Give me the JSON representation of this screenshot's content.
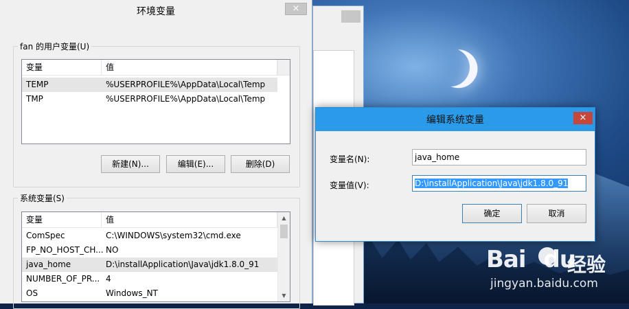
{
  "env_dialog": {
    "title": "环境变量",
    "close": "×",
    "user_group": {
      "label": "fan 的用户变量(U)",
      "columns": [
        "变量",
        "值"
      ],
      "rows": [
        {
          "name": "TEMP",
          "value": "%USERPROFILE%\\AppData\\Local\\Temp"
        },
        {
          "name": "TMP",
          "value": "%USERPROFILE%\\AppData\\Local\\Temp"
        }
      ],
      "buttons": {
        "new": "新建(N)...",
        "edit": "编辑(E)...",
        "delete": "删除(D)"
      }
    },
    "system_group": {
      "label": "系统变量(S)",
      "columns": [
        "变量",
        "值"
      ],
      "rows": [
        {
          "name": "ComSpec",
          "value": "C:\\WINDOWS\\system32\\cmd.exe"
        },
        {
          "name": "FP_NO_HOST_CH...",
          "value": "NO"
        },
        {
          "name": "java_home",
          "value": "D:\\installApplication\\Java\\jdk1.8.0_91"
        },
        {
          "name": "NUMBER_OF_PR...",
          "value": "4"
        },
        {
          "name": "OS",
          "value": "Windows_NT"
        }
      ]
    }
  },
  "edit_dialog": {
    "title": "编辑系统变量",
    "close": "×",
    "name_label": "变量名(N):",
    "name_value": "java_home",
    "value_label": "变量值(V):",
    "value_value": "D:\\installApplication\\Java\\jdk1.8.0_91",
    "ok": "确定",
    "cancel": "取消"
  },
  "watermark": {
    "logo": "Bai",
    "logo_suffix": "du",
    "text": "经验",
    "url": "jingyan.baidu.com"
  }
}
